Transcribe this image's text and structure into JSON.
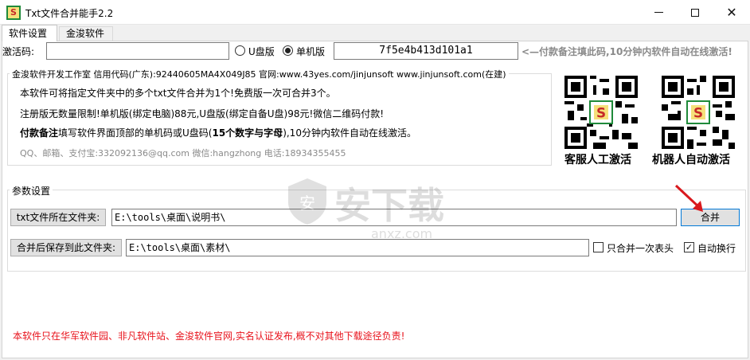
{
  "window": {
    "title": "Txt文件合并能手2.2",
    "icon_letter": "S",
    "controls": {
      "minimize": "minimize-icon",
      "maximize": "maximize-icon",
      "close": "close-icon"
    }
  },
  "tabs": [
    {
      "label": "软件设置",
      "active": true
    },
    {
      "label": "金浚软件",
      "active": false
    }
  ],
  "activation": {
    "label": "激活码:",
    "value": "",
    "mode_usb_label": "U盘版",
    "mode_pc_label": "单机版",
    "selected_mode": "单机版",
    "machine_code": "7f5e4b413d101a1",
    "hint": "<—付款备注填此码,10分钟内软件自动在线激活!"
  },
  "info": {
    "company_line": "金浚软件开发工作室 信用代码(广东):92440605MA4X049J85 官网:www.43yes.com/jinjunsoft  www.jinjunsoft.com(在建)",
    "line1": "本软件可将指定文件夹中的多个txt文件合并为1个!免费版一次可合并3个。",
    "line2": "注册版无数量限制!单机版(绑定电脑)88元,U盘版(绑定自备U盘)98元!微信二维码付款!",
    "line3_bold": "付款备注",
    "line3_a": "填写软件界面顶部的单机码或U盘码(",
    "line3_bold2": "15个数字与字母",
    "line3_b": "),10分钟内软件自动在线激活。",
    "contact": "QQ、邮箱、支付宝:332092136@qq.com   微信:hangzhong   电话:18934355455"
  },
  "qr_codes": [
    {
      "caption": "客服人工激活",
      "icon": "qr-code-icon"
    },
    {
      "caption": "机器人自动激活",
      "icon": "qr-code-icon"
    }
  ],
  "params": {
    "legend": "参数设置",
    "source_label": "txt文件所在文件夹:",
    "source_value": "E:\\tools\\桌面\\说明书\\",
    "merge_button": "合并",
    "output_label": "合并后保存到此文件夹:",
    "output_value": "E:\\tools\\桌面\\素材\\",
    "header_once_label": "只合并一次表头",
    "header_once_checked": false,
    "auto_newline_label": "自动换行",
    "auto_newline_checked": true
  },
  "footer": {
    "notice": "本软件只在华军软件园、非凡软件站、金浚软件官网,实名认证发布,概不对其他下载途径负责!"
  },
  "watermark": {
    "text": "安下载",
    "sub": "anxz.com"
  },
  "colors": {
    "accent_blue": "#0078d7",
    "notice_red": "#e8131c",
    "hint_gray": "#8a8a8a",
    "arrow_red": "#d9191e"
  }
}
